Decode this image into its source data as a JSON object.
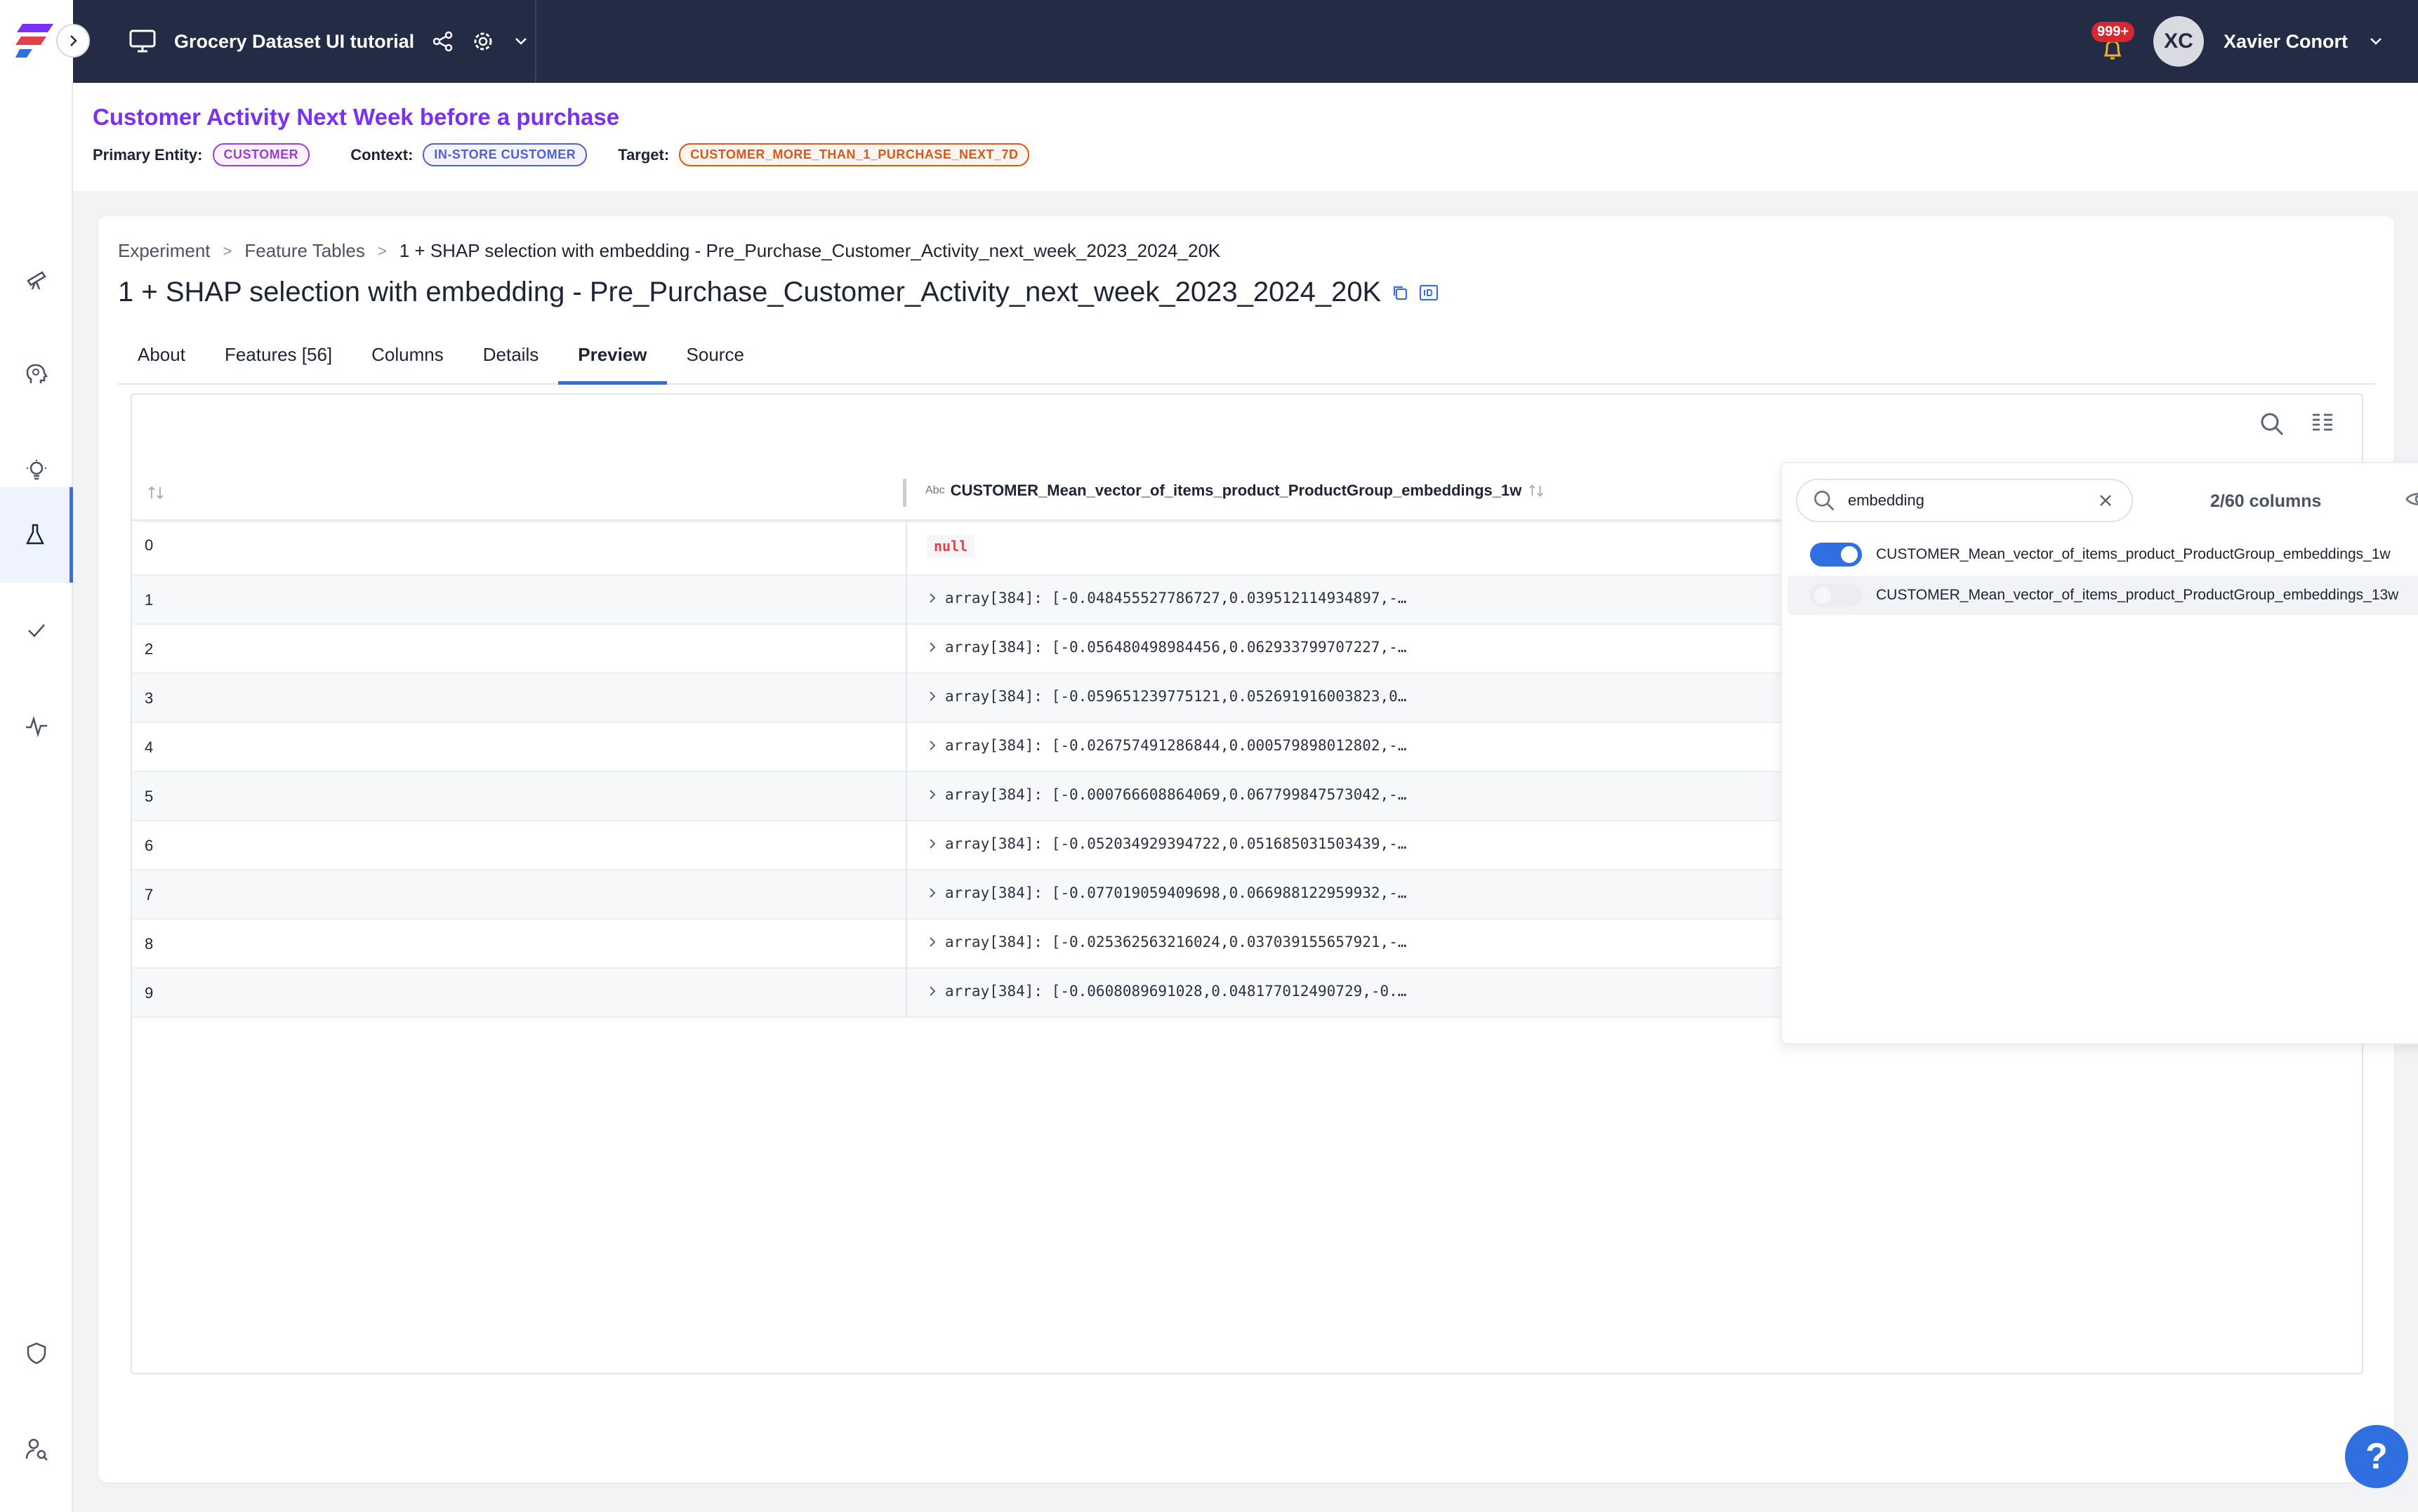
{
  "project": {
    "title": "Grocery Dataset UI tutorial"
  },
  "user": {
    "initials": "XC",
    "name": "Xavier Conort",
    "notifications": "999+"
  },
  "context": {
    "use_case": "Customer Activity Next Week before a purchase",
    "primary_entity_label": "Primary Entity:",
    "primary_entity": "CUSTOMER",
    "context_label": "Context:",
    "context_value": "IN-STORE CUSTOMER",
    "target_label": "Target:",
    "target": "CUSTOMER_MORE_THAN_1_PURCHASE_NEXT_7D"
  },
  "breadcrumb": {
    "items": [
      "Experiment",
      "Feature Tables",
      "1 + SHAP selection with embedding - Pre_Purchase_Customer_Activity_next_week_2023_2024_20K"
    ],
    "separator": ">"
  },
  "page_title": "1 + SHAP selection with embedding - Pre_Purchase_Customer_Activity_next_week_2023_2024_20K",
  "tabs": [
    {
      "label": "About"
    },
    {
      "label": "Features [56]"
    },
    {
      "label": "Columns"
    },
    {
      "label": "Details"
    },
    {
      "label": "Preview",
      "active": true
    },
    {
      "label": "Source"
    }
  ],
  "table": {
    "column_type": "Abc",
    "column_header": "CUSTOMER_Mean_vector_of_items_product_ProductGroup_embeddings_1w",
    "rows": [
      {
        "index": "0",
        "value": "null",
        "is_null": true
      },
      {
        "index": "1",
        "value": "array[384]: [-0.048455527786727,0.039512114934897,-…"
      },
      {
        "index": "2",
        "value": "array[384]: [-0.056480498984456,0.062933799707227,-…"
      },
      {
        "index": "3",
        "value": "array[384]: [-0.059651239775121,0.052691916003823,0…"
      },
      {
        "index": "4",
        "value": "array[384]: [-0.026757491286844,0.000579898012802,-…"
      },
      {
        "index": "5",
        "value": "array[384]: [-0.000766608864069,0.067799847573042,-…"
      },
      {
        "index": "6",
        "value": "array[384]: [-0.052034929394722,0.051685031503439,-…"
      },
      {
        "index": "7",
        "value": "array[384]: [-0.077019059409698,0.066988122959932,-…"
      },
      {
        "index": "8",
        "value": "array[384]: [-0.025362563216024,0.037039155657921,-…"
      },
      {
        "index": "9",
        "value": "array[384]: [-0.0608089691028,0.048177012490729,-0.…"
      }
    ]
  },
  "column_chooser": {
    "search_value": "embedding",
    "count": "2/60 columns",
    "options": [
      {
        "label": "CUSTOMER_Mean_vector_of_items_product_ProductGroup_embeddings_1w",
        "enabled": true
      },
      {
        "label": "CUSTOMER_Mean_vector_of_items_product_ProductGroup_embeddings_13w",
        "enabled": false
      }
    ]
  },
  "help_label": "?",
  "colors": {
    "topbar": "#232b45",
    "accent": "#2f6fe0",
    "use_case": "#7b2ff7",
    "null": "#e0414a"
  }
}
